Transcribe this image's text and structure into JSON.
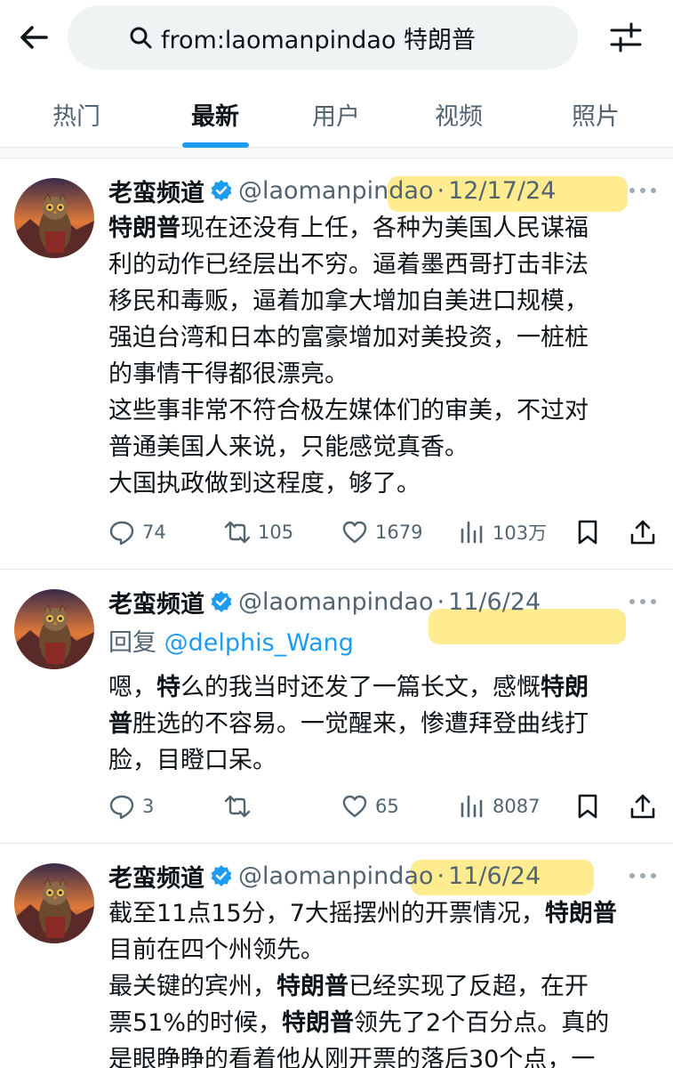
{
  "search": {
    "query": "from:laomanpindao 特朗普"
  },
  "tabs": [
    "热门",
    "最新",
    "用户",
    "视频",
    "照片"
  ],
  "active_tab": "最新",
  "colors": {
    "accent": "#1d9bf0",
    "highlight": "#ffdd46",
    "text": "#0f1419",
    "secondary": "#536471"
  },
  "tweets": [
    {
      "name": "老蛮频道",
      "handle": "@laomanpindao",
      "separator": "·",
      "date": "12/17/24",
      "body": [
        [
          {
            "b": "特朗普"
          },
          {
            "t": "现在还没有上任，各种为美国人民谋福"
          }
        ],
        [
          {
            "t": "利的动作已经层出不穷。逼着墨西哥打击非法"
          }
        ],
        [
          {
            "t": "移民和毒贩，逼着加拿大增加自美进口规模，"
          }
        ],
        [
          {
            "t": "强迫台湾和日本的富豪增加对美投资，一桩桩"
          }
        ],
        [
          {
            "t": "的事情干得都很漂亮。"
          }
        ],
        [
          {
            "t": "这些事非常不符合极左媒体们的审美，不过对"
          }
        ],
        [
          {
            "t": "普通美国人来说，只能感觉真香。"
          }
        ],
        [
          {
            "t": "大国执政做到这程度，够了。"
          }
        ]
      ],
      "replies": "74",
      "retweets": "105",
      "likes": "1679",
      "views": "103万"
    },
    {
      "name": "老蛮频道",
      "handle": "@laomanpindao",
      "separator": "·",
      "date": "11/6/24",
      "reply_prefix": "回复",
      "reply_to": "@delphis_Wang",
      "body": [
        [
          {
            "t": "嗯，"
          },
          {
            "b": "特"
          },
          {
            "t": "么的我当时还发了一篇长文，感慨"
          },
          {
            "b": "特朗"
          }
        ],
        [
          {
            "b": "普"
          },
          {
            "t": "胜选的不容易。一觉醒来，惨遭拜登曲线打"
          }
        ],
        [
          {
            "t": "脸，目瞪口呆。"
          }
        ]
      ],
      "replies": "3",
      "retweets": "",
      "likes": "65",
      "views": "8087"
    },
    {
      "name": "老蛮频道",
      "handle": "@laomanpindao",
      "separator": "·",
      "date": "11/6/24",
      "body": [
        [
          {
            "t": "截至11点15分，7大摇摆州的开票情况，"
          },
          {
            "b": "特朗普"
          }
        ],
        [
          {
            "t": "目前在四个州领先。"
          }
        ],
        [
          {
            "t": "最关键的宾州，"
          },
          {
            "b": "特朗普"
          },
          {
            "t": "已经实现了反超，在开"
          }
        ],
        [
          {
            "t": "票51%的时候，"
          },
          {
            "b": "特朗普"
          },
          {
            "t": "领先了2个百分点。真的"
          }
        ],
        [
          {
            "t": "是眼睁睁的看着他从刚开票的落后30个点，一"
          }
        ]
      ]
    }
  ]
}
